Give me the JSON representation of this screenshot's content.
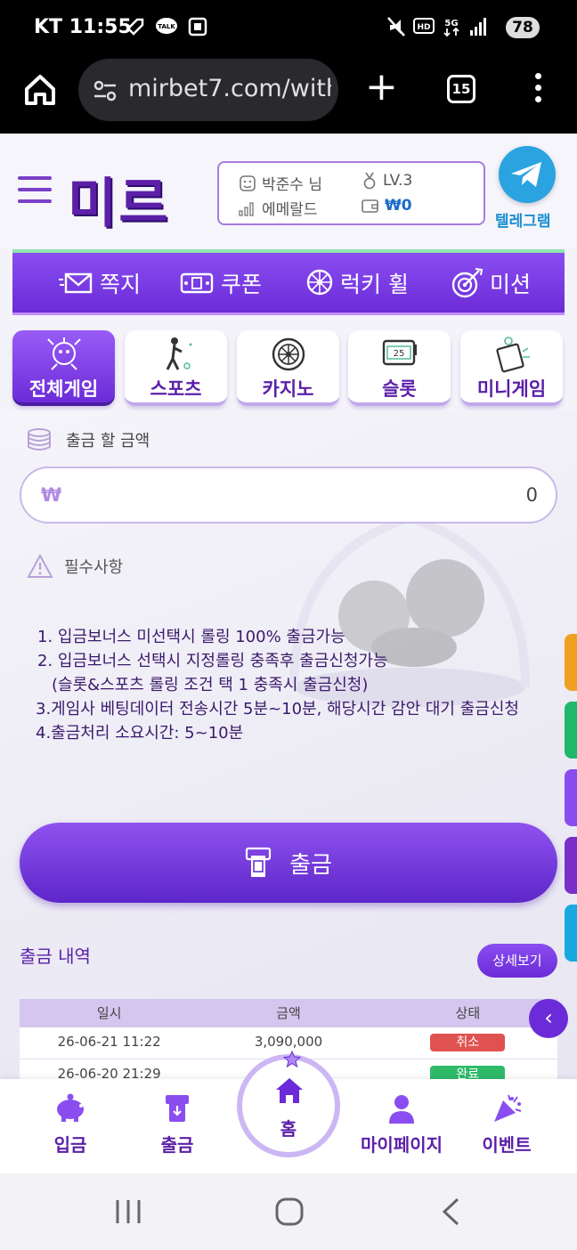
{
  "status": {
    "carrier": "KT",
    "time": "11:55",
    "battery": "78"
  },
  "browser": {
    "url": "mirbet7.com/with",
    "tab_count": "15"
  },
  "header": {
    "logo": "미르",
    "username": "박준수 님",
    "level": "LV.3",
    "tier": "에메랄드",
    "balance": "₩0",
    "telegram_label": "텔레그램"
  },
  "menu": [
    {
      "label": "쪽지",
      "icon": "mail-icon"
    },
    {
      "label": "쿠폰",
      "icon": "coupon-icon"
    },
    {
      "label": "럭키 휠",
      "icon": "wheel-icon"
    },
    {
      "label": "미션",
      "icon": "target-icon"
    }
  ],
  "categories": [
    {
      "label": "전체게임",
      "active": true
    },
    {
      "label": "스포츠",
      "active": false
    },
    {
      "label": "카지노",
      "active": false
    },
    {
      "label": "슬롯",
      "active": false
    },
    {
      "label": "미니게임",
      "active": false
    }
  ],
  "withdraw": {
    "amount_label": "출금 할 금액",
    "currency": "₩",
    "amount_value": "0",
    "required_title": "필수사항",
    "notes": [
      "1. 입금보너스 미선택시 롤링 100% 출금가능",
      "2. 입금보너스 선택시 지정롤링 충족후 출금신청가능",
      "(슬롯&스포츠 롤링 조건 택 1 충족시 출금신청)",
      "3.게임사 베팅데이터 전송시간 5분~10분, 해당시간 감안 대기 출금신청",
      "4.출금처리 소요시간: 5~10분"
    ],
    "button_label": "출금"
  },
  "history": {
    "title": "출금 내역",
    "detail_label": "상세보기",
    "columns": [
      "일시",
      "금액",
      "상태"
    ],
    "rows": [
      {
        "date": "26-06-21 11:22",
        "amount": "3,090,000",
        "status": "취소",
        "status_color": "#e0524f"
      },
      {
        "date": "26-06-20 21:29",
        "amount": "",
        "status": "완료",
        "status_color": "#2fba6a"
      }
    ]
  },
  "side_tab_colors": [
    "#f0a020",
    "#1fb86a",
    "#8a4ef0",
    "#7a2fc9",
    "#1aa8e0"
  ],
  "bottom_nav": [
    {
      "label": "입금",
      "icon": "piggy-bank-icon"
    },
    {
      "label": "출금",
      "icon": "atm-icon"
    },
    {
      "label": "홈",
      "icon": "home-icon"
    },
    {
      "label": "마이페이지",
      "icon": "user-icon"
    },
    {
      "label": "이벤트",
      "icon": "party-icon"
    }
  ]
}
